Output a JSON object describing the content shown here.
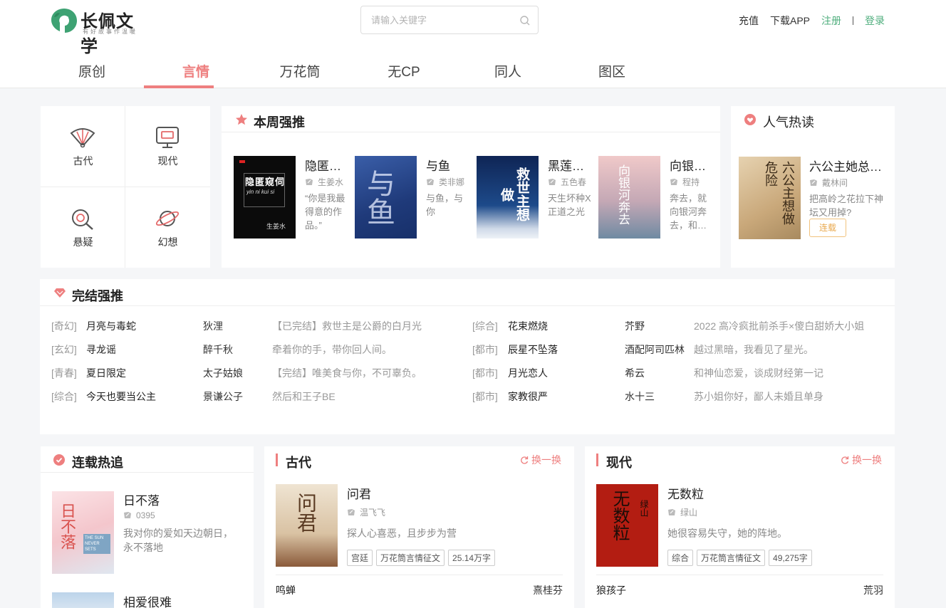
{
  "header": {
    "logo_name": "长佩文学",
    "logo_slogan": "有好故事作温暖",
    "search_placeholder": "请输入关键字",
    "links": {
      "recharge": "充值",
      "download": "下载APP",
      "register": "注册",
      "login": "登录"
    }
  },
  "nav": {
    "tabs": [
      "原创",
      "言情",
      "万花筒",
      "无CP",
      "同人",
      "图区"
    ],
    "active": "言情"
  },
  "categories": [
    "古代",
    "现代",
    "悬疑",
    "幻想"
  ],
  "weekly": {
    "title": "本周强推",
    "books": [
      {
        "title": "隐匿…",
        "author": "生姜水",
        "desc": "“你是我最得意的作品。”",
        "cover_text": "隐匿窥伺",
        "cover_sub": "yin ni kui si",
        "cover_author": "生姜水"
      },
      {
        "title": "与鱼",
        "author": "类非娜",
        "desc": "与鱼，与你",
        "cover_text": "与鱼"
      },
      {
        "title": "黑莲…",
        "author": "五色春",
        "desc": "天生坏种X 正道之光",
        "cover_text": "救世主想做"
      },
      {
        "title": "向银…",
        "author": "程持",
        "desc": "奔去，就向银河奔去，和…",
        "cover_text": "向银河奔去"
      }
    ]
  },
  "hot": {
    "title": "人气热读",
    "book": {
      "title": "六公主她总…",
      "author": "戴林间",
      "desc": "把高岭之花拉下神坛又用掉?",
      "tag": "连载",
      "cover_text": "六公主想做危险"
    }
  },
  "finished": {
    "title": "完结强推",
    "rows": [
      {
        "left": {
          "type": "[奇幻]",
          "name": "月亮与毒蛇",
          "author": "狄浬",
          "desc": "【已完结】救世主是公爵的白月光"
        },
        "right": {
          "type": "[综合]",
          "name": "花束燃烧",
          "author": "芥野",
          "desc": "2022 高冷疯批前杀手×傻白甜娇大小姐"
        }
      },
      {
        "left": {
          "type": "[玄幻]",
          "name": "寻龙谣",
          "author": "醉千秋",
          "desc": "牵着你的手，带你回人间。"
        },
        "right": {
          "type": "[都市]",
          "name": "辰星不坠落",
          "author": "酒配阿司匹林",
          "desc": "越过黑暗，我看见了星光。"
        }
      },
      {
        "left": {
          "type": "[青春]",
          "name": "夏日限定",
          "author": "太子姑娘",
          "desc": "【完结】唯美食与你，不可辜负。"
        },
        "right": {
          "type": "[都市]",
          "name": "月光恋人",
          "author": "希云",
          "desc": "和神仙恋爱，谈成财经第一记"
        }
      },
      {
        "left": {
          "type": "[综合]",
          "name": "今天也要当公主",
          "author": "景谦公子",
          "desc": "然后和王子BE"
        },
        "right": {
          "type": "[都市]",
          "name": "家教很严",
          "author": "水十三",
          "desc": "苏小姐你好，鄙人未婚且单身"
        }
      }
    ]
  },
  "serial": {
    "title": "连载热追",
    "books": [
      {
        "title": "日不落",
        "author": "0395",
        "desc": "我对你的爱如天边朝日，永不落地",
        "cover_text": "日不落",
        "cover_en": "THE SUN NEVER SETS"
      },
      {
        "title": "相爱很难",
        "author": "",
        "desc": ""
      }
    ]
  },
  "ancient": {
    "title": "古代",
    "refresh": "换一换",
    "book": {
      "title": "问君",
      "author": "温飞飞",
      "desc": "探人心喜恶，且步步为营",
      "tags": [
        "宫廷",
        "万花筒言情征文",
        "25.14万字"
      ],
      "cover_text": "问君"
    },
    "list": [
      {
        "name": "鸣蝉",
        "author": "熹桂芬"
      }
    ]
  },
  "modern": {
    "title": "现代",
    "refresh": "换一换",
    "book": {
      "title": "无数粒",
      "author": "绿山",
      "desc": "她很容易失守，她的阵地。",
      "tags": [
        "综合",
        "万花筒言情征文",
        "49,275字"
      ],
      "cover_text": "无数粒",
      "cover_author": "绿山"
    },
    "list": [
      {
        "name": "狼孩子",
        "author": "荒羽"
      }
    ]
  },
  "colors": {
    "accent": "#ee7f7f",
    "green": "#4fae7d",
    "serial_tag": "#e9a84c"
  }
}
